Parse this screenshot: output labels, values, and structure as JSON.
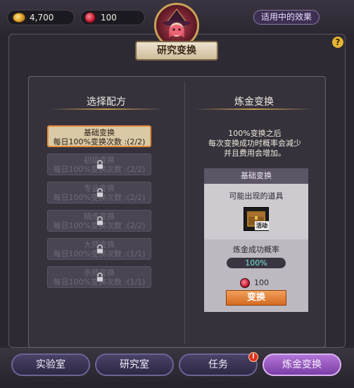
{
  "resources": {
    "gold": "4,700",
    "potion": "100"
  },
  "effects_button": "适用中的效果",
  "title": "研究变换",
  "help_icon": "?",
  "left_panel": {
    "title": "选择配方",
    "recipes": [
      {
        "name": "基础变换",
        "count": "每日100%变换次数 :(2/2)",
        "locked": false,
        "selected": true
      },
      {
        "name": "初级变换",
        "count": "每日100%变换次数 :(2/2)",
        "locked": true,
        "selected": false
      },
      {
        "name": "专业变换",
        "count": "每日100%变换次数 :(2/2)",
        "locked": true,
        "selected": false
      },
      {
        "name": "精炼变换",
        "count": "每日100%变换次数 :(2/2)",
        "locked": true,
        "selected": false
      },
      {
        "name": "大师变换",
        "count": "每日100%变换次数 :(1/1)",
        "locked": true,
        "selected": false
      },
      {
        "name": "宗师变换",
        "count": "每日100%变换次数 :(1/1)",
        "locked": true,
        "selected": false
      }
    ]
  },
  "right_panel": {
    "title": "炼金变换",
    "description": [
      "100%变换之后",
      "每次变换成功时概率会减少",
      "并且费用会增加。"
    ],
    "card": {
      "header": "基础变换",
      "items_label": "可能出现的道具",
      "item_badge": "活动",
      "rate_label": "炼金成功概率",
      "rate_value": "100%",
      "cost": "100",
      "button": "变换"
    }
  },
  "tabs": [
    {
      "label": "实验室",
      "active": false
    },
    {
      "label": "研究室",
      "active": false
    },
    {
      "label": "任务",
      "active": false,
      "badge": "!"
    },
    {
      "label": "炼金变换",
      "active": true
    }
  ],
  "colors": {
    "accent_orange": "#d66a22",
    "active_tab": "#a05bc8",
    "rate_text": "#7be7df"
  }
}
